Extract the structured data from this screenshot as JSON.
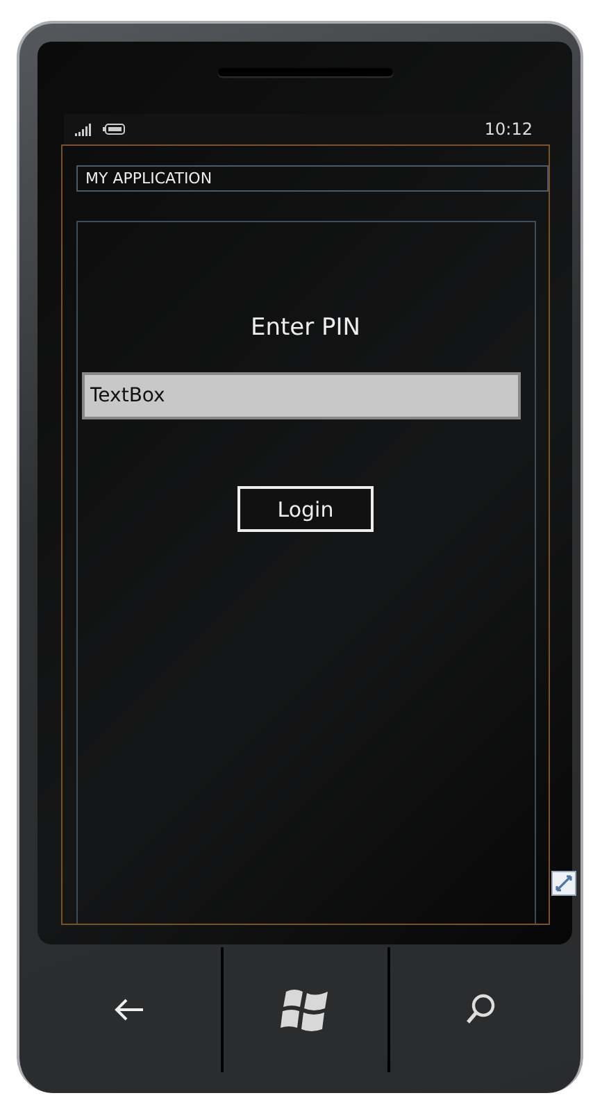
{
  "status_bar": {
    "time": "10:12"
  },
  "app": {
    "title": "MY APPLICATION"
  },
  "page": {
    "heading": "Enter PIN",
    "pin_field": {
      "value": "TextBox"
    },
    "login_button": {
      "label": "Login"
    }
  }
}
